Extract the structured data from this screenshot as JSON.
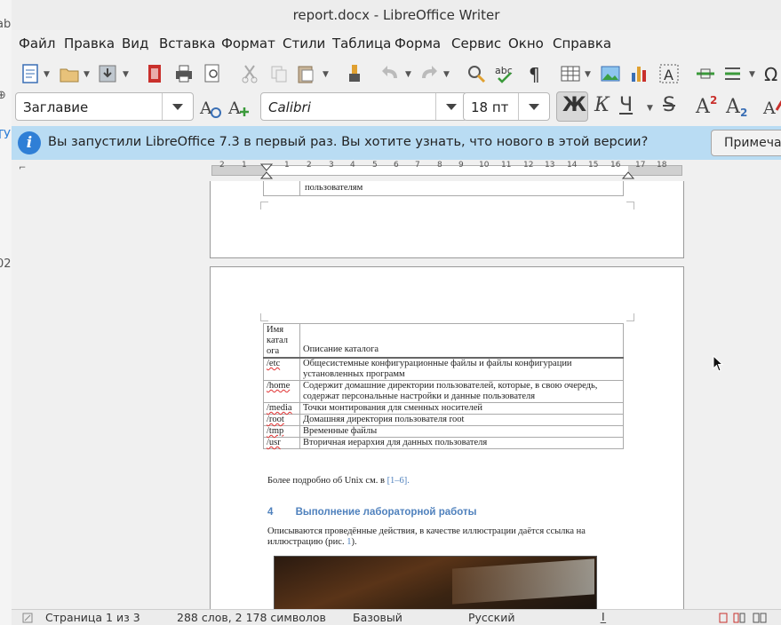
{
  "window": {
    "title": "report.docx - LibreOffice Writer"
  },
  "menu": [
    "Файл",
    "Правка",
    "Вид",
    "Вставка",
    "Формат",
    "Стили",
    "Таблица",
    "Форма",
    "Сервис",
    "Окно",
    "Справка"
  ],
  "formatting": {
    "paragraph_style": "Заглавие",
    "font_name": "Calibri",
    "font_size": "18 пт",
    "bold": "Ж",
    "italic": "К",
    "underline": "Ч",
    "strike": "S",
    "superscript": "A",
    "subscript": "A",
    "superscript_sup": "2",
    "subscript_sub": "2"
  },
  "infobar": {
    "message": "Вы запустили LibreOffice 7.3 в первый раз. Вы хотите узнать, что нового в этой версии?",
    "button": "Примечан"
  },
  "ruler": {
    "ticks": [
      "2",
      "1",
      "1",
      "2",
      "3",
      "4",
      "5",
      "6",
      "7",
      "8",
      "9",
      "10",
      "11",
      "12",
      "13",
      "14",
      "15",
      "16",
      "17",
      "18"
    ]
  },
  "document": {
    "prev_cell_text": "пользователям",
    "table": {
      "headers": [
        "Имя\nкатал\nога",
        "Описание каталога"
      ],
      "rows": [
        [
          "/etc",
          "Общесистемные конфигурационные файлы и файлы конфигурации установленных программ"
        ],
        [
          "/home",
          "Содержит домашние директории пользователей, которые, в свою очередь, содержат персональные настройки и данные пользователя"
        ],
        [
          "/media",
          "Точки монтирования для сменных носителей"
        ],
        [
          "/root",
          "Домашняя директория пользователя root"
        ],
        [
          "/tmp",
          "Временные файлы"
        ],
        [
          "/usr",
          "Вторичная иерархия для данных пользователя"
        ]
      ]
    },
    "para1_text": "Более подробно об Unix см. в ",
    "para1_ref": "[1–6].",
    "heading_number": "4",
    "heading_text": "Выполнение лабораторной работы",
    "para2_text": "Описываются проведённые действия, в качестве иллюстрации даётся ссылка на иллюстрацию (рис. ",
    "para2_ref": "1",
    "para2_end": ")."
  },
  "statusbar": {
    "page": "Страница 1 из 3",
    "words": "288 слов, 2 178 символов",
    "style": "Базовый",
    "language": "Русский"
  },
  "colors": {
    "infobar": "#b9dcf3",
    "heading": "#4f81bd",
    "accent": "#2f7fd6"
  }
}
